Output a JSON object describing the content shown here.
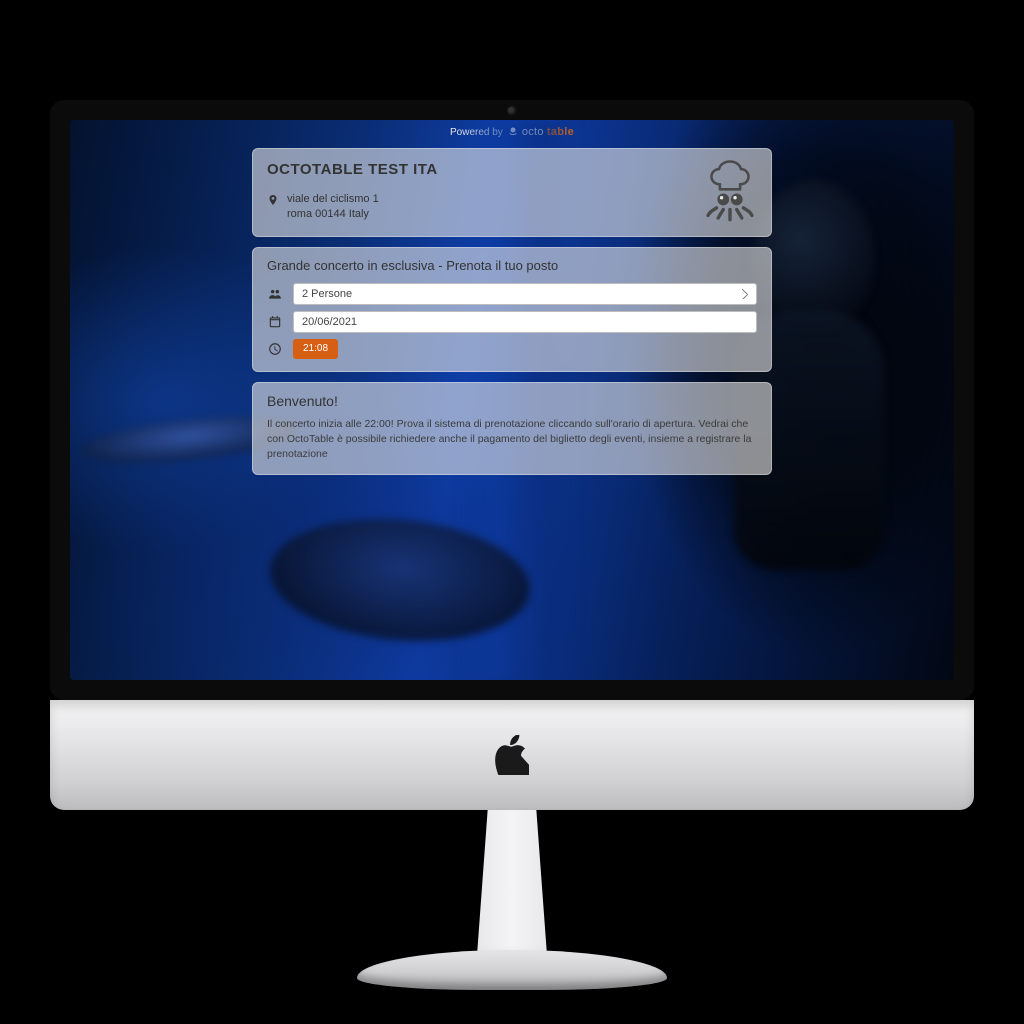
{
  "powered_by_label": "Powered by",
  "brand": {
    "octo": "octo",
    "table": "table"
  },
  "header": {
    "title": "OCTOTABLE TEST ITA",
    "address_line1": "viale del ciclismo 1",
    "address_line2": "roma 00144 Italy"
  },
  "booking": {
    "title": "Grande concerto in esclusiva - Prenota il tuo posto",
    "people_value": "2 Persone",
    "date_value": "20/06/2021",
    "time_value": "21:08"
  },
  "welcome": {
    "title": "Benvenuto!",
    "body": "Il concerto inizia alle 22:00! Prova il sistema di prenotazione cliccando sull'orario di apertura. Vedrai che con OctoTable è possibile richiedere anche il pagamento del biglietto degli eventi, insieme a registrare la prenotazione"
  },
  "colors": {
    "accent": "#d65f14"
  }
}
